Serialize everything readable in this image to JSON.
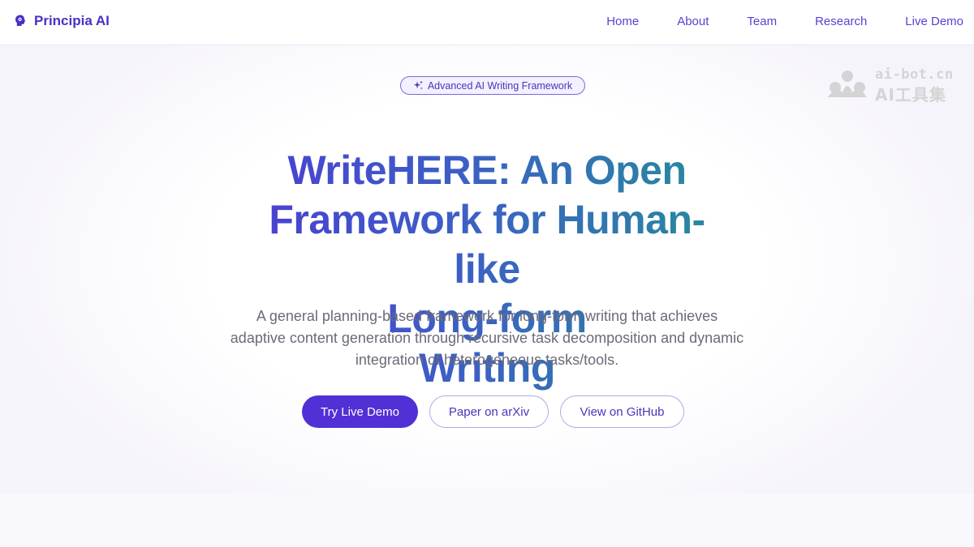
{
  "brand": {
    "name": "Principia AI",
    "icon": "brain-head-icon",
    "color": "#4c2fc7"
  },
  "nav": {
    "items": [
      {
        "label": "Home"
      },
      {
        "label": "About"
      },
      {
        "label": "Team"
      },
      {
        "label": "Research"
      },
      {
        "label": "Live Demo"
      }
    ]
  },
  "hero": {
    "badge": {
      "icon": "sparkles-icon",
      "label": "Advanced AI Writing Framework"
    },
    "title_lines": [
      "WriteHERE: An Open",
      "Framework for Human-like",
      "Long-form Writing"
    ],
    "subtitle": "A general planning-based framework for long-form writing that achieves adaptive content generation through recursive task decomposition and dynamic integration of heterogeneous tasks/tools.",
    "buttons": {
      "primary": "Try Live Demo",
      "arxiv": "Paper on arXiv",
      "github": "View on GitHub"
    }
  },
  "watermark": {
    "line1": "ai-bot.cn",
    "line2": "AI工具集"
  },
  "colors": {
    "accent": "#5130d6",
    "gradient_start": "#4f33d6",
    "gradient_end": "#1f9a8e",
    "text_muted": "#6b6a78"
  }
}
